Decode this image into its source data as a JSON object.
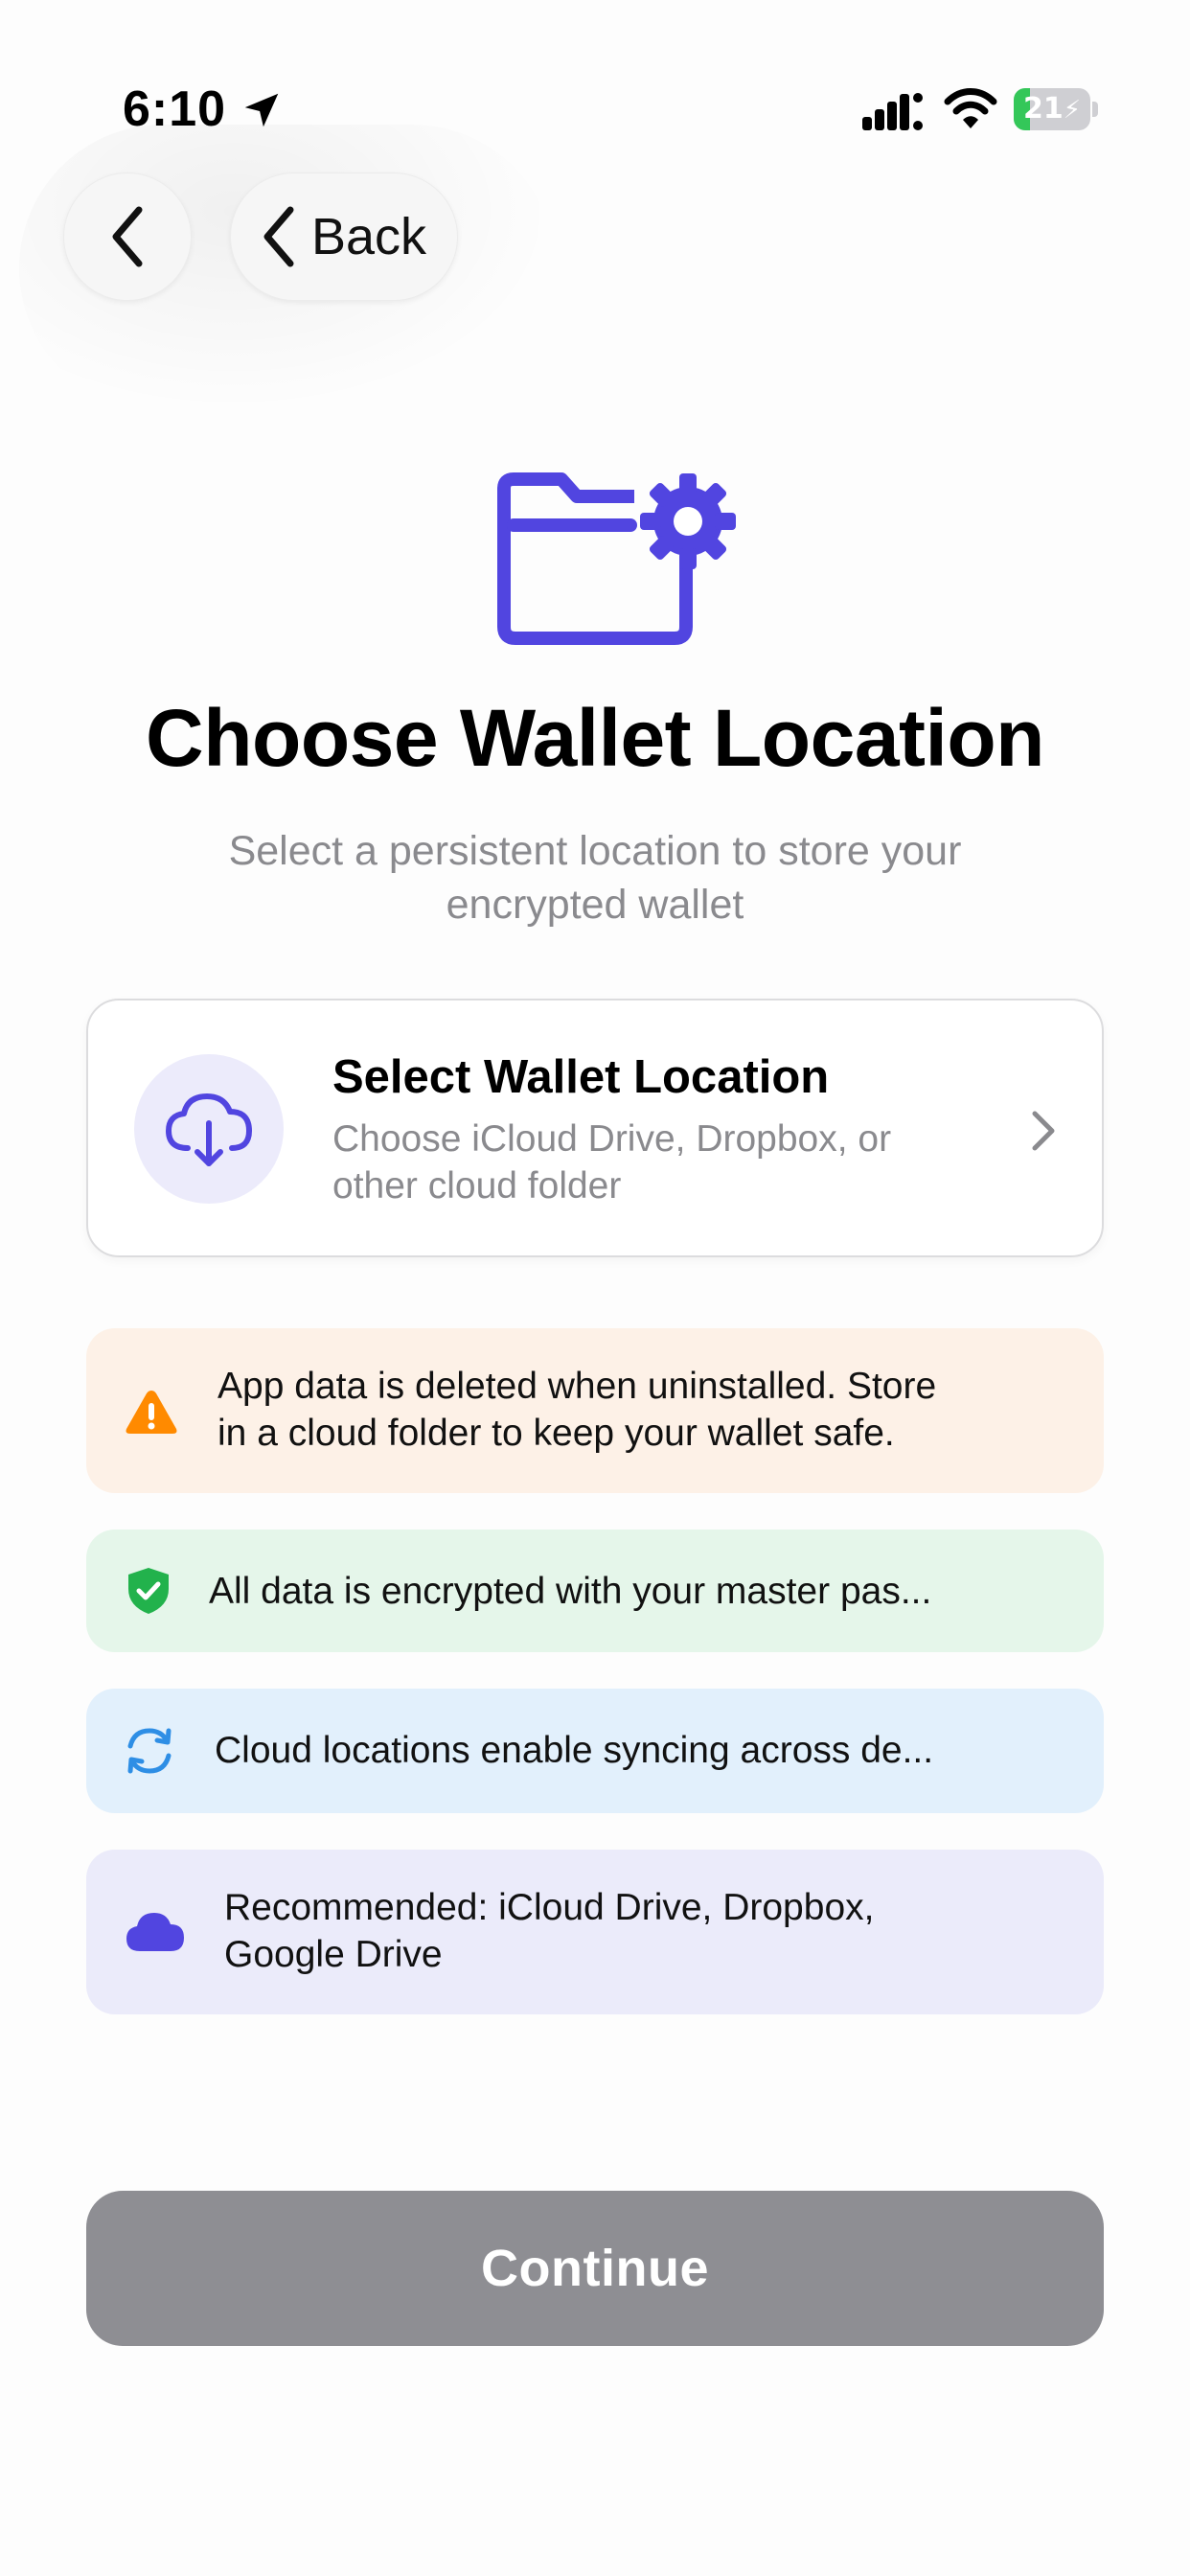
{
  "status_bar": {
    "time": "6:10",
    "battery_percent": "21",
    "battery_level": 0.21,
    "icons": [
      "location-arrow-icon",
      "cellular-signal-icon",
      "wifi-icon",
      "battery-charging-icon"
    ]
  },
  "nav": {
    "back_icon": "chevron-left-icon",
    "back_label": "Back"
  },
  "hero": {
    "icon": "folder-gear-icon",
    "title": "Choose Wallet Location",
    "subtitle": "Select a persistent location to store your encrypted wallet"
  },
  "location_card": {
    "icon": "cloud-download-icon",
    "title": "Select Wallet Location",
    "description": "Choose iCloud Drive, Dropbox, or other cloud folder",
    "chevron_icon": "chevron-right-icon"
  },
  "banners": [
    {
      "icon": "warning-triangle-icon",
      "text_line1": "App data is deleted when uninstalled. Store",
      "text_line2": "in a cloud folder to keep your wallet safe."
    },
    {
      "icon": "shield-check-icon",
      "text_line1": "All data is encrypted with your master pas..."
    },
    {
      "icon": "sync-arrows-icon",
      "text_line1": "Cloud locations enable syncing across de..."
    },
    {
      "icon": "cloud-icon",
      "text_line1": "Recommended: iCloud Drive, Dropbox,",
      "text_line2": "Google Drive"
    }
  ],
  "continue_button": {
    "label": "Continue"
  },
  "colors": {
    "accent": "#5145e0",
    "warning": "#ff8a00",
    "success": "#22b24c",
    "sync": "#2e8ee5",
    "button_disabled": "#8e8e93"
  }
}
